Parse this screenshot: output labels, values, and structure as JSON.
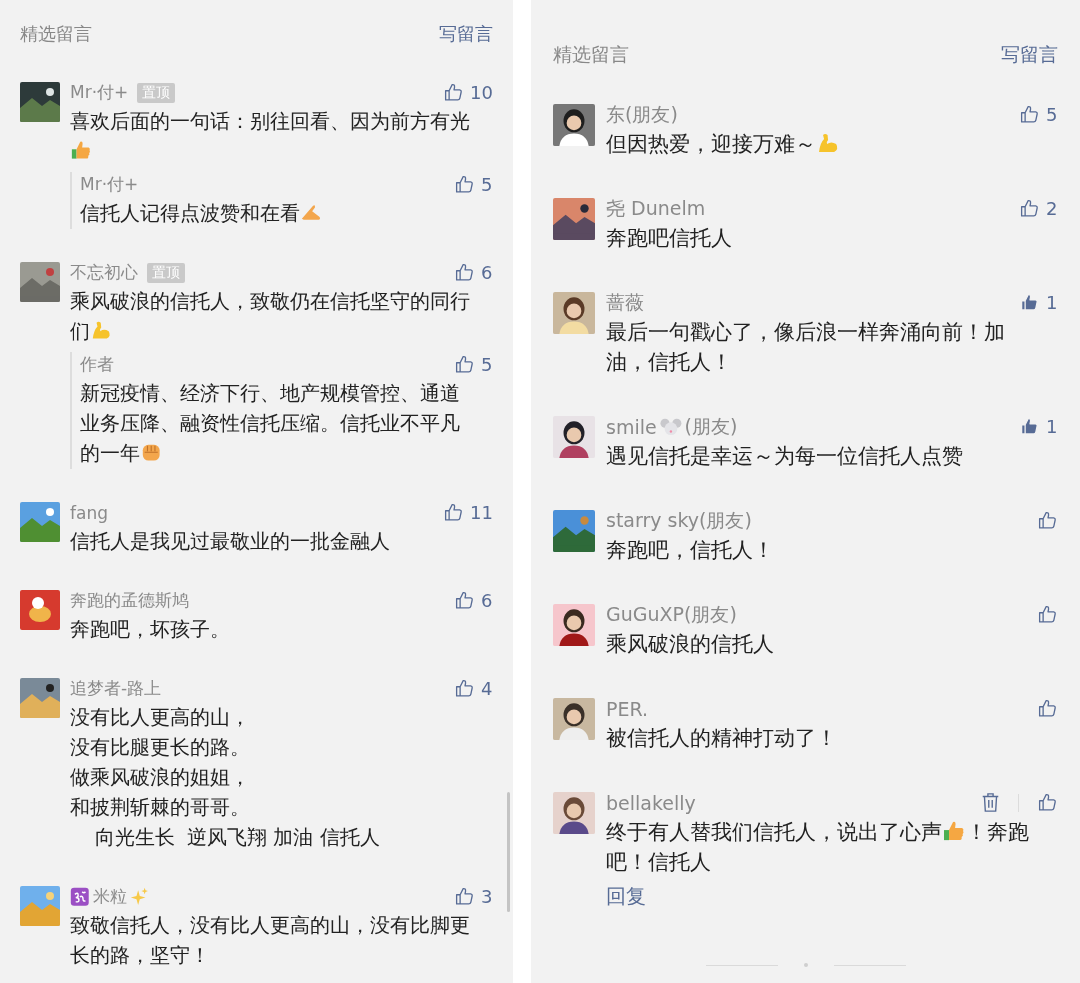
{
  "panels": [
    {
      "title": "精选留言",
      "write_label": "写留言",
      "comments": [
        {
          "name": [
            {
              "kind": "text",
              "text": "Mr·付+"
            }
          ],
          "pinned_label": "置顶",
          "likes": "10",
          "liked": false,
          "body": [
            {
              "kind": "text",
              "text": "喜欢后面的一句话：别往回看、因为前方有光"
            },
            {
              "kind": "thumbs-up"
            }
          ],
          "replies": [
            {
              "name": [
                {
                  "kind": "text",
                  "text": "Mr·付+"
                }
              ],
              "likes": "5",
              "liked": false,
              "body": [
                {
                  "kind": "text",
                  "text": "信托人记得点波赞和在看"
                },
                {
                  "kind": "hand"
                }
              ]
            }
          ]
        },
        {
          "name": [
            {
              "kind": "text",
              "text": "不忘初心"
            }
          ],
          "pinned_label": "置顶",
          "likes": "6",
          "liked": false,
          "body": [
            {
              "kind": "text",
              "text": "乘风破浪的信托人，致敬仍在信托坚守的同行们"
            },
            {
              "kind": "muscle"
            }
          ],
          "replies": [
            {
              "name": [
                {
                  "kind": "text",
                  "text": "作者"
                }
              ],
              "likes": "5",
              "liked": false,
              "body": [
                {
                  "kind": "text",
                  "text": "新冠疫情、经济下行、地产规模管控、通道业务压降、融资性信托压缩。信托业不平凡的一年"
                },
                {
                  "kind": "fist"
                }
              ]
            }
          ]
        },
        {
          "name": [
            {
              "kind": "text",
              "text": "fang"
            }
          ],
          "likes": "11",
          "liked": false,
          "body": [
            {
              "kind": "text",
              "text": "信托人是我见过最敬业的一批金融人"
            }
          ]
        },
        {
          "name": [
            {
              "kind": "text",
              "text": "奔跑的孟德斯鸠"
            }
          ],
          "likes": "6",
          "liked": false,
          "body": [
            {
              "kind": "text",
              "text": "奔跑吧，坏孩子。"
            }
          ]
        },
        {
          "name": [
            {
              "kind": "text",
              "text": "追梦者-路上"
            }
          ],
          "likes": "4",
          "liked": false,
          "body": [
            {
              "kind": "line",
              "text": "没有比人更高的山，"
            },
            {
              "kind": "line",
              "text": "没有比腿更长的路。"
            },
            {
              "kind": "line",
              "text": "做乘风破浪的姐姐，"
            },
            {
              "kind": "line",
              "text": "和披荆斩棘的哥哥。"
            },
            {
              "kind": "line",
              "text": "    向光生长  逆风飞翔 加油 信托人"
            }
          ]
        },
        {
          "name": [
            {
              "kind": "om"
            },
            {
              "kind": "text",
              "text": "米粒"
            },
            {
              "kind": "sparkles"
            }
          ],
          "likes": "3",
          "liked": false,
          "body": [
            {
              "kind": "text",
              "text": "致敬信托人，没有比人更高的山，没有比脚更长的路，坚守！"
            }
          ]
        }
      ]
    },
    {
      "title": "精选留言",
      "write_label": "写留言",
      "comments": [
        {
          "name": [
            {
              "kind": "text",
              "text": "东(朋友)"
            }
          ],
          "likes": "5",
          "liked": false,
          "body": [
            {
              "kind": "text",
              "text": "但因热爱，迎接万难～"
            },
            {
              "kind": "muscle"
            }
          ]
        },
        {
          "name": [
            {
              "kind": "text",
              "text": "尧 Dunelm"
            }
          ],
          "likes": "2",
          "liked": false,
          "body": [
            {
              "kind": "text",
              "text": "奔跑吧信托人"
            }
          ]
        },
        {
          "name": [
            {
              "kind": "text",
              "text": "蔷薇"
            }
          ],
          "likes": "1",
          "liked": true,
          "body": [
            {
              "kind": "text",
              "text": "最后一句戳心了，像后浪一样奔涌向前！加油，信托人！"
            }
          ]
        },
        {
          "name": [
            {
              "kind": "text",
              "text": "smile"
            },
            {
              "kind": "mouse"
            },
            {
              "kind": "text",
              "text": "(朋友)"
            }
          ],
          "likes": "1",
          "liked": true,
          "body": [
            {
              "kind": "text",
              "text": "遇见信托是幸运～为每一位信托人点赞"
            }
          ]
        },
        {
          "name": [
            {
              "kind": "text",
              "text": "starry sky(朋友)"
            }
          ],
          "liked": false,
          "body": [
            {
              "kind": "text",
              "text": "奔跑吧，信托人！"
            }
          ]
        },
        {
          "name": [
            {
              "kind": "text",
              "text": "GuGuXP(朋友)"
            }
          ],
          "liked": false,
          "body": [
            {
              "kind": "text",
              "text": "乘风破浪的信托人"
            }
          ]
        },
        {
          "name": [
            {
              "kind": "text",
              "text": "PER."
            }
          ],
          "liked": false,
          "body": [
            {
              "kind": "text",
              "text": "被信托人的精神打动了！"
            }
          ]
        },
        {
          "name": [
            {
              "kind": "text",
              "text": "bellakelly"
            }
          ],
          "liked": false,
          "deletable": true,
          "body": [
            {
              "kind": "text",
              "text": "终于有人替我们信托人，说出了心声"
            },
            {
              "kind": "thumbs-up"
            },
            {
              "kind": "text",
              "text": "！奔跑吧！信托人"
            }
          ],
          "reply_label": "回复"
        }
      ]
    }
  ]
}
